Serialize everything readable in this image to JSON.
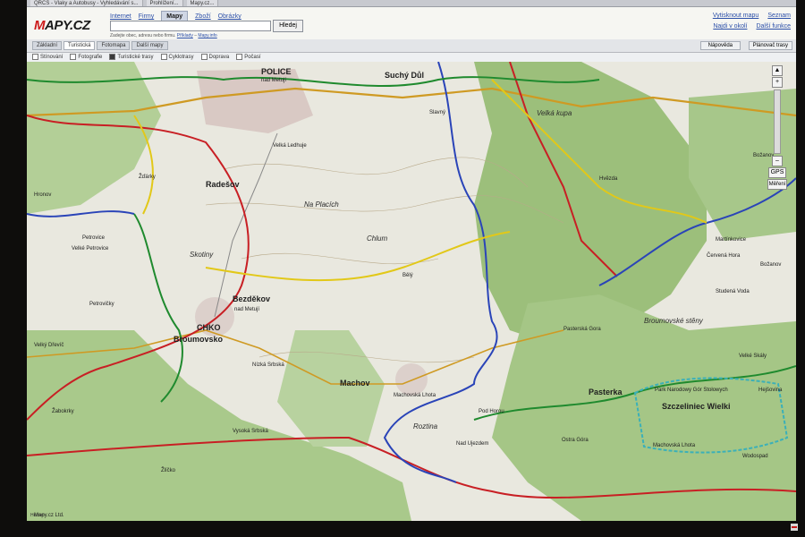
{
  "browser": {
    "tabs": [
      "QRCS - Vlaky a Autobusy - Vyhledávání s...",
      "Prohlížení...",
      "Mapy.cz..."
    ]
  },
  "site": {
    "logo": "Mapy.cz"
  },
  "nav": {
    "items": [
      "Internet",
      "Firmy",
      "Mapy",
      "Zboží",
      "Obrázky"
    ],
    "active": "Mapy"
  },
  "search": {
    "button": "Hledej",
    "hint": "Zadejte obec, adresu nebo firmu.",
    "hint_link1": "Příklady",
    "hint_link2": "Mapy.info"
  },
  "right_links": {
    "print": "Vytisknout mapu",
    "list": "Seznam",
    "nearby": "Najdi v okolí",
    "more": "Další funkce"
  },
  "map_tabs": {
    "items": [
      "Základní",
      "Turistická",
      "Fotomapa",
      "Další mapy"
    ],
    "active": "Turistická"
  },
  "map_buttons": {
    "help": "Nápověda",
    "planner": "Plánovač trasy"
  },
  "layers": [
    {
      "label": "Stínování",
      "on": false
    },
    {
      "label": "Fotografie",
      "on": false
    },
    {
      "label": "Turistické trasy",
      "on": true
    },
    {
      "label": "Cyklotrasy",
      "on": false
    },
    {
      "label": "Doprava",
      "on": false
    },
    {
      "label": "Počasí",
      "on": false
    }
  ],
  "map_labels": {
    "police": "POLICE",
    "nad_metuji": "nad Metují",
    "suchy_dul": "Suchý Důl",
    "slavny": "Slavný",
    "velka_kupa": "Velká kupa",
    "zdarky": "Žďárky",
    "radesov": "Radešov",
    "velka_ledhuje": "Velká Ledhuje",
    "na_placich": "Na Placích",
    "chlum": "Chlum",
    "bely": "Bělý",
    "skotiny": "Skotiny",
    "bezdekov": "Bezděkov",
    "bezdekov2": "nad Metují",
    "petrovicky": "Petrovičky",
    "petrovice": "Petrovice",
    "velke_petrovice": "Velké Petrovice",
    "cho_broumovsko": "CHKO",
    "broumovsko": "Broumovsko",
    "nizka_srbska": "Nízká Srbská",
    "machov": "Machov",
    "machovska_lhota": "Machovská Lhota",
    "rozna": "Roztina",
    "pod_horou": "Pod Horou",
    "nad_ujezdem": "Nad Ujezdem",
    "broumovske_steny": "Broumovské stěny",
    "pasterka": "Pasterka",
    "pasterska_gora": "Pasterská Gora",
    "szczeliniec": "Szczeliniec Wielki",
    "park_narodowy": "Park Narodowy Gór Stołowych",
    "ostra_gora": "Ostra Góra",
    "vysoka_srbska": "Vysoká Srbská",
    "zabokrky": "Žabokrky",
    "hejsovina": "Hejšovina",
    "bozanov": "Božanov",
    "stitna": "Studená Voda",
    "machovska2": "Machovská Lhota",
    "hvezda": "Hvězda",
    "zlicko": "Žlíčko",
    "wodospad": "Wodospad",
    "velky_drevic": "Velký Dřevíč",
    "mc": "Mapy.cz Ltd.",
    "velke_skaly": "Velké Skály",
    "cervena_hora": "Červená Hora",
    "hronov": "Hronov",
    "martinkovice": "Martínkovice",
    "bozanov2": "Božanov"
  },
  "zoom": {
    "plus": "+",
    "minus": "–",
    "gps": "GPS",
    "measure": "Měření"
  },
  "footer": {
    "copyright": "Hotovo"
  },
  "colors": {
    "trail_red": "#c81f24",
    "trail_blue": "#2a44b8",
    "trail_green": "#1f8a2e",
    "trail_yellow": "#e2c818",
    "road": "#cf9a23",
    "forest": "#9cbf7b",
    "meadow": "#e9e8df"
  }
}
